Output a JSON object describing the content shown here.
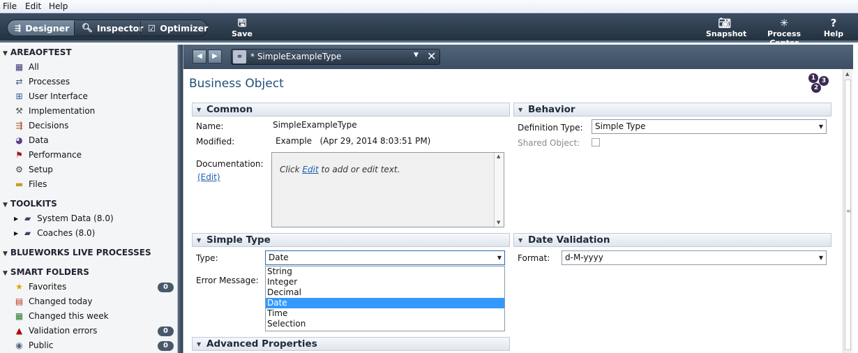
{
  "menu": {
    "file": "File",
    "edit": "Edit",
    "help": "Help"
  },
  "toolbar": {
    "designer": "Designer",
    "inspector": "Inspector",
    "optimizer": "Optimizer",
    "save": "Save",
    "snapshot": "Snapshot",
    "process_center": "Process Center",
    "help": "Help"
  },
  "nav": {
    "area_title": "AREAOFTEST",
    "area_items": [
      {
        "label": "All",
        "icon": "grid-icon"
      },
      {
        "label": "Processes",
        "icon": "process-icon"
      },
      {
        "label": "User Interface",
        "icon": "ui-icon"
      },
      {
        "label": "Implementation",
        "icon": "tools-icon"
      },
      {
        "label": "Decisions",
        "icon": "decision-icon"
      },
      {
        "label": "Data",
        "icon": "data-icon"
      },
      {
        "label": "Performance",
        "icon": "flag-icon"
      },
      {
        "label": "Setup",
        "icon": "gear-icon"
      },
      {
        "label": "Files",
        "icon": "folder-icon"
      }
    ],
    "toolkits_title": "TOOLKITS",
    "toolkits": [
      {
        "label": "System Data (8.0)"
      },
      {
        "label": "Coaches (8.0)"
      }
    ],
    "blueworks_title": "BLUEWORKS LIVE PROCESSES",
    "smart_title": "SMART FOLDERS",
    "smart_items": [
      {
        "label": "Favorites",
        "icon": "star-icon",
        "badge": "0"
      },
      {
        "label": "Changed today",
        "icon": "calendar-icon",
        "badge": ""
      },
      {
        "label": "Changed this week",
        "icon": "week-icon",
        "badge": ""
      },
      {
        "label": "Validation errors",
        "icon": "warning-icon",
        "badge": "0"
      },
      {
        "label": "Public",
        "icon": "public-icon",
        "badge": "0"
      }
    ]
  },
  "editor": {
    "tab_title": "* SimpleExampleType",
    "page_title": "Business Object",
    "common": {
      "header": "Common",
      "name_label": "Name:",
      "name_value": "SimpleExampleType",
      "modified_label": "Modified:",
      "modified_value": "Example   (Apr 29, 2014 8:03:51 PM)",
      "doc_label": "Documentation:",
      "doc_edit": "(Edit)",
      "doc_text_pre": "Click ",
      "doc_text_link": "Edit",
      "doc_text_post": " to add or edit text."
    },
    "behavior": {
      "header": "Behavior",
      "deftype_label": "Definition Type:",
      "deftype_value": "Simple Type",
      "shared_label": "Shared Object:"
    },
    "simple_type": {
      "header": "Simple Type",
      "type_label": "Type:",
      "type_value": "Date",
      "error_label": "Error Message:",
      "options": [
        "String",
        "Integer",
        "Decimal",
        "Date",
        "Time",
        "Selection"
      ],
      "selected": "Date"
    },
    "date_validation": {
      "header": "Date Validation",
      "format_label": "Format:",
      "format_value": "d-M-yyyy"
    },
    "advanced": {
      "header": "Advanced Properties"
    }
  }
}
